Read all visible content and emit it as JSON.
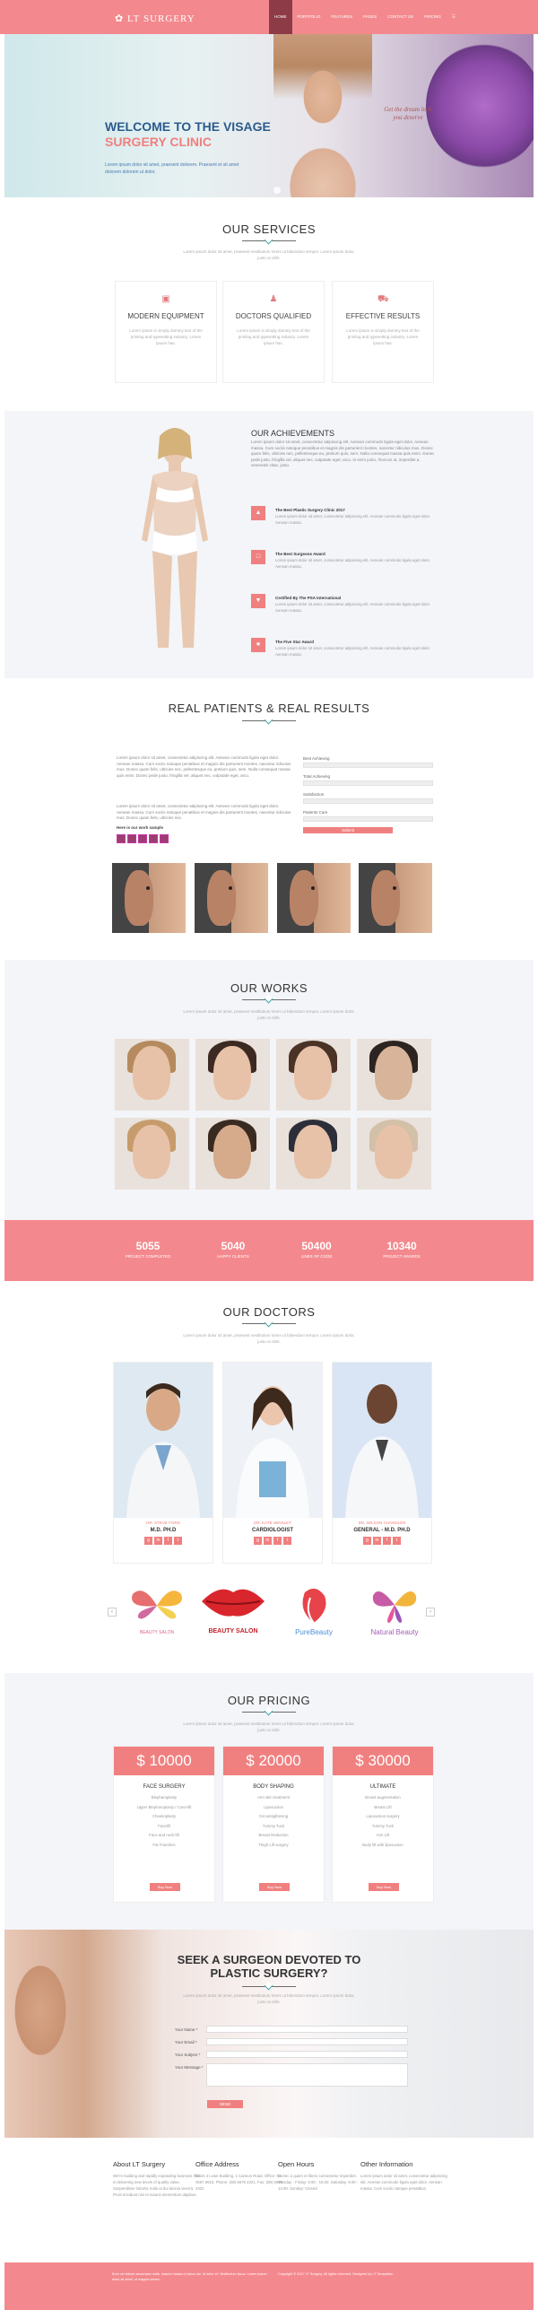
{
  "brand": {
    "logo": "LT SURGERY",
    "accent": "#f3898e",
    "dark_accent": "#8d3b46"
  },
  "nav": {
    "items": [
      "HOME",
      "PORTFOLIO",
      "FEATURES",
      "PAGES",
      "CONTACT US",
      "PRICING"
    ],
    "menu_icon": "hamburger-icon"
  },
  "hero": {
    "title_line1": "WELCOME TO THE VISAGE",
    "title_line2": "SURGERY CLINIC",
    "text": "Lorem ipsum dolor sit amet, praesent dolorem. Praesent et sit amet dolorem dolorem ut dolor.",
    "quote": "Get the dream look you deserve"
  },
  "services": {
    "title": "OUR SERVICES",
    "subtitle": "Lorem ipsum dolor sit amet, praesent vestibulum lorem ut bibendum tempor. Lorem ipsum dolor, justo ut nibh.",
    "cards": [
      {
        "icon": "medkit-icon",
        "title": "MODERN EQUIPMENT",
        "text": "Lorem ipsum is simply dummy text of the printing and typesetting industry. Lorem ipsum has."
      },
      {
        "icon": "doctor-icon",
        "title": "DOCTORS QUALIFIED",
        "text": "Lorem ipsum is simply dummy text of the printing and typesetting industry. Lorem ipsum has."
      },
      {
        "icon": "ambulance-icon",
        "title": "EFFECTIVE RESULTS",
        "text": "Lorem ipsum is simply dummy text of the printing and typesetting industry. Lorem ipsum has."
      }
    ]
  },
  "achievements": {
    "title": "OUR ACHIEVEMENTS",
    "text": "Lorem ipsum dolor sit amet, consectetur adipiscing elit. Aenean commodo ligula eget dolor. Aenean massa. Cum sociis natoque penatibus et magnis dis parturient montes, nascetur ridiculus mus. Donec quam felis, ultricies nec, pellentesque eu, pretium quis, sem. Nulla consequat massa quis enim. Donec pede justo, fringilla vel, aliquet nec, vulputate eget, arcu. In enim justo, rhoncus ut, imperdiet a, venenatis vitae, justo.",
    "items": [
      {
        "icon": "trophy-icon",
        "title": "The Best Plastic Surgery Clinic 2017",
        "text": "Lorem ipsum dolor sit amet, consectetur adipiscing elit. Aenean commodo ligula eget dolor. Aenean massa."
      },
      {
        "icon": "award-icon",
        "title": "The Best Surgeons Award",
        "text": "Lorem ipsum dolor sit amet, consectetur adipiscing elit. Aenean commodo ligula eget dolor. Aenean massa."
      },
      {
        "icon": "certificate-icon",
        "title": "Certified By The PSA International",
        "text": "Lorem ipsum dolor sit amet, consectetur adipiscing elit. Aenean commodo ligula eget dolor. Aenean massa."
      },
      {
        "icon": "star-icon",
        "title": "The Five Star Award",
        "text": "Lorem ipsum dolor sit amet, consectetur adipiscing elit. Aenean commodo ligula eget dolor. Aenean massa."
      }
    ]
  },
  "results": {
    "title": "REAL PATIENTS & REAL RESULTS",
    "para1": "Lorem ipsum dolor sit amet, consectetur adipiscing elit. Aenean commodo ligula eget dolor. Aenean massa. Cum sociis natoque penatibus et magnis dis parturient montes, nascetur ridiculus mus. Donec quam felis, ultricies nec, pellentesque eu, pretium quis, sem. Nulla consequat massa quis enim. Donec pede justo, fringilla vel, aliquet nec, vulputate eget, arcu.",
    "para2": "Lorem ipsum dolor sit amet, consectetur adipiscing elit. Aenean commodo ligula eget dolor. Aenean massa. Cum sociis natoque penatibus et magnis dis parturient montes, nascetur ridiculus mus. Donec quam felis, ultricies nec.",
    "work_label": "Here is our work sample",
    "form": {
      "fields": [
        "Best Achieving",
        "Total Achieving",
        "Satisfaction",
        "Patients Cure"
      ],
      "button": "Submit"
    }
  },
  "works": {
    "title": "OUR WORKS",
    "subtitle": "Lorem ipsum dolor sit amet, praesent vestibulum lorem ut bibendum tempor. Lorem ipsum dolor, justo ut nibh."
  },
  "stats": [
    {
      "value": "5055",
      "label": "PROJECT COMPLETED"
    },
    {
      "value": "5040",
      "label": "HAPPY CLIENTS"
    },
    {
      "value": "50400",
      "label": "LINES OF CODE"
    },
    {
      "value": "10340",
      "label": "PROJECT AWARDS"
    }
  ],
  "doctors": {
    "title": "OUR DOCTORS",
    "subtitle": "Lorem ipsum dolor sit amet, praesent vestibulum lorem ut bibendum tempor. Lorem ipsum dolor, justo ut nibh.",
    "list": [
      {
        "name": "DR. STEVE FORD",
        "title": "M.D. PH.D"
      },
      {
        "name": "DR. KATE WINSLET",
        "title": "CARDIOLOGIST"
      },
      {
        "name": "DR. WILSON CHANDLER",
        "title": "GENERAL - M.D. PH.D"
      }
    ]
  },
  "partners": [
    "BEAUTY SALON",
    "BEAUTY SALON",
    "PureBeauty",
    "Natural Beauty"
  ],
  "pricing": {
    "title": "OUR PRICING",
    "subtitle": "Lorem ipsum dolor sit amet, praesent vestibulum lorem ut bibendum tempor. Lorem ipsum dolor, justo ut nibh.",
    "plans": [
      {
        "price": "$ 10000",
        "name": "FACE SURGERY",
        "features": [
          "Blepharoplasty",
          "Upper Blepharoplasty / Cons-lift",
          "Cheekoplasty",
          "Facelift",
          "Face and neck lift",
          "Fat Transfers"
        ],
        "button": "Buy Now"
      },
      {
        "price": "$ 20000",
        "name": "BODY SHAPING",
        "features": [
          "Arm skin treatment",
          "Liposuction",
          "Circumtightening",
          "Tummy Tuck",
          "Breast Reduction",
          "Thigh Lift surgery"
        ],
        "button": "Buy Now"
      },
      {
        "price": "$ 30000",
        "name": "ULTIMATE",
        "features": [
          "Breast augmentation",
          "Breast Lift",
          "Liposuction surgery",
          "Tummy Tuck",
          "Arm Lift",
          "Body lift with liposuction"
        ],
        "button": "Buy Now"
      }
    ]
  },
  "contact": {
    "title_line1": "SEEK A SURGEON DEVOTED TO",
    "title_line2": "PLASTIC SURGERY?",
    "subtitle": "Lorem ipsum dolor sit amet, praesent vestibulum lorem ut bibendum tempor. Lorem ipsum dolor, justo ut nibh.",
    "fields": [
      "Your Name *",
      "Your Email *",
      "Your Subject *",
      "Your Message *"
    ],
    "button": "SEND"
  },
  "footer": {
    "cols": [
      {
        "title": "About LT Surgery",
        "text": "We're building and rapidly expanding business that is delivering new levels of quality value. Suspendisse lobortis nulla ut dui lacinia viverra. Proin tincidunt nisi et mauris elementum dapibus."
      },
      {
        "title": "Office Address",
        "text": "Block 4 Lowe Building, 1 Cannon Road, Office: 03 4567 8910, Phone: (08) 5678 4321, Fax: (08) 5678 4322"
      },
      {
        "title": "Open Hours",
        "text": "Donec a quam et libero consectetur imperdiet. Monday - Friday: 9.00 - 18.00. Saturday: 9.00 - 14.00. Sunday: Closed."
      },
      {
        "title": "Other Information",
        "text": "Lorem ipsum dolor sit amet, consectetur adipiscing elit. Aenean commodo ligula eget dolor. Aenean massa. Cum sociis natoque penatibus."
      }
    ],
    "bottom_left": "Eum vel labore accumsan nulla, mauris massa ut lacus dui, id tortor et. Vestibulum lacus. Lorem ipsum dolor sit amet, ut magna ornare.",
    "bottom_right": "Copyright © 2017 LT Surgery. All rights reserved. Designed by LT Templates."
  }
}
